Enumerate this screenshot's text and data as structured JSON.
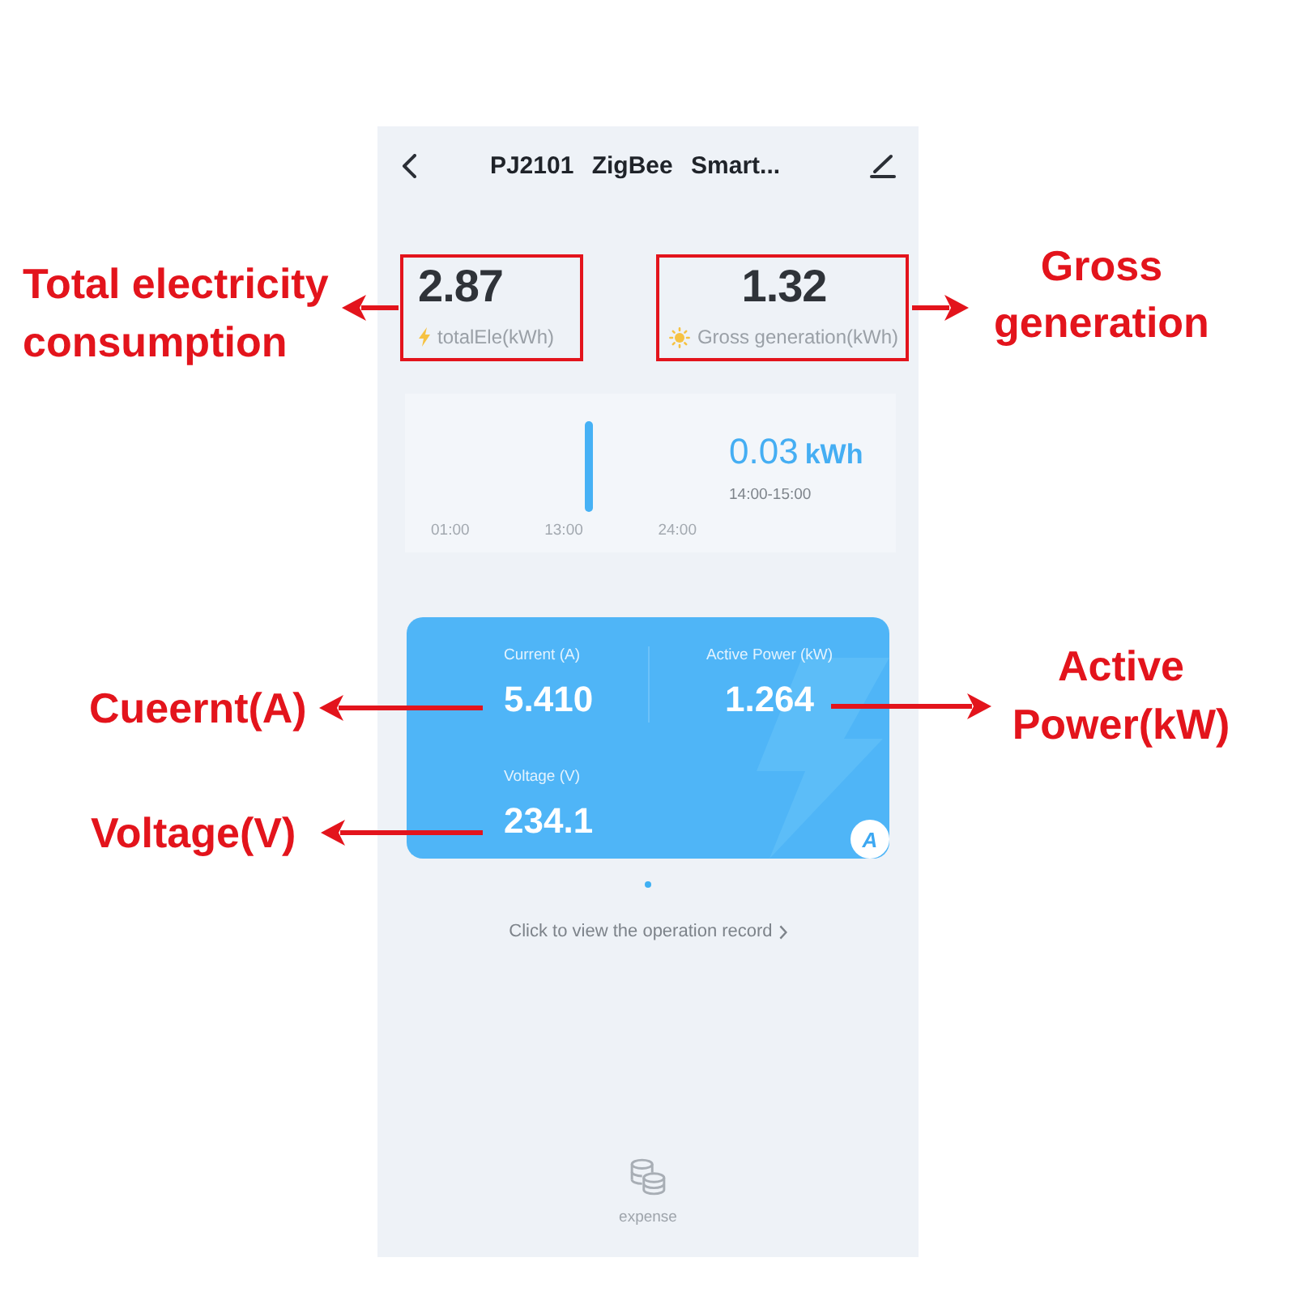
{
  "header": {
    "title": "PJ2101 ZigBee Smart..."
  },
  "stats": [
    {
      "kind": "consumption",
      "value": "2.87",
      "label": "totalEle(kWh)"
    },
    {
      "kind": "generation",
      "value": "1.32",
      "label": "Gross generation(kWh)"
    }
  ],
  "usage_chart": {
    "reading": "0.03",
    "unit": "kWh",
    "period": "14:00-15:00",
    "x_labels": [
      "01:00",
      "13:00",
      "24:00"
    ]
  },
  "readings_card": {
    "readings": [
      {
        "label": "Current (A)",
        "value": "5.410"
      },
      {
        "label": "Active Power (kW)",
        "value": "1.264"
      },
      {
        "label": "Voltage (V)",
        "value": "234.1"
      }
    ],
    "badge": "A"
  },
  "page_dots": [
    {
      "selected": true
    }
  ],
  "record_link": {
    "text": "Click to view the operation record"
  },
  "bottom_tab": {
    "label": "expense"
  },
  "left_callouts": [
    {
      "text": "Total electricity consumption",
      "framed": true
    },
    {
      "text": "Cueernt(A)",
      "framed": false
    },
    {
      "text": "Voltage(V)",
      "framed": false
    }
  ],
  "right_callouts": [
    {
      "text": "Gross generation",
      "framed": true
    },
    {
      "text": "Active Power(kW)",
      "framed": false
    }
  ]
}
